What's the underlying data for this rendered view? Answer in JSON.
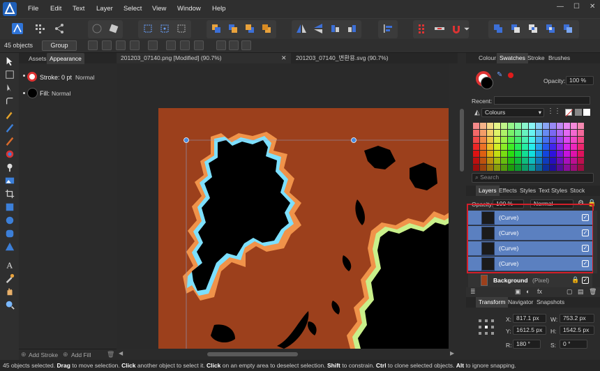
{
  "menubar": {
    "items": [
      "File",
      "Edit",
      "Text",
      "Layer",
      "Select",
      "View",
      "Window",
      "Help"
    ]
  },
  "context": {
    "object_count": "45 objects",
    "group_button": "Group"
  },
  "left_panel": {
    "tabs": [
      "Assets",
      "Appearance"
    ],
    "stroke_label": "Stroke: 0 pt",
    "stroke_mode": "Normal",
    "fill_label": "Fill:",
    "fill_mode": "Normal",
    "add_stroke": "Add Stroke",
    "add_fill": "Add Fill"
  },
  "documents": {
    "tabs": [
      "201203_07140.png [Modified] (90.7%)",
      "201203_07140_변환용.svg (90.7%)"
    ]
  },
  "right_panel": {
    "top_tabs": [
      "Colour",
      "Swatches",
      "Stroke",
      "Brushes"
    ],
    "opacity_label": "Opacity:",
    "opacity_value": "100 %",
    "recent_label": "Recent:",
    "palette_name": "Colours",
    "search_placeholder": "Search",
    "layer_tabs": [
      "Layers",
      "Effects",
      "Styles",
      "Text Styles",
      "Stock"
    ],
    "layers_opacity_label": "Opacity:",
    "layers_opacity_value": "100 %",
    "blend_mode": "Normal",
    "layers": [
      {
        "name": "(Curve)"
      },
      {
        "name": "(Curve)"
      },
      {
        "name": "(Curve)"
      },
      {
        "name": "(Curve)"
      }
    ],
    "background_layer": {
      "name": "Background",
      "type": "(Pixel)"
    },
    "transform_tabs": [
      "Transform",
      "Navigator",
      "Snapshots"
    ],
    "transform": {
      "x_label": "X:",
      "x": "817.1 px",
      "y_label": "Y:",
      "y": "1612.5 px",
      "w_label": "W:",
      "w": "753.2 px",
      "h_label": "H:",
      "h": "1542.5 px",
      "r_label": "R:",
      "r": "180 °",
      "s_label": "S:",
      "s": "0 °"
    }
  },
  "status": {
    "prefix": "45 objects selected.",
    "drag": "Drag",
    "t1": " to move selection. ",
    "click": "Click",
    "t2": " another object to select it. ",
    "click2": "Click",
    "t3": " on an empty area to deselect selection. ",
    "shift": "Shift",
    "t4": " to constrain. ",
    "ctrl": "Ctrl",
    "t5": " to clone selected objects. ",
    "alt": "Alt",
    "t6": " to ignore snapping."
  },
  "colors": {
    "canvas_bg": "#9c401c",
    "selection_highlight": "#d21f2a",
    "layer_row": "#5b80c0",
    "brand": "#3b7ee0"
  }
}
